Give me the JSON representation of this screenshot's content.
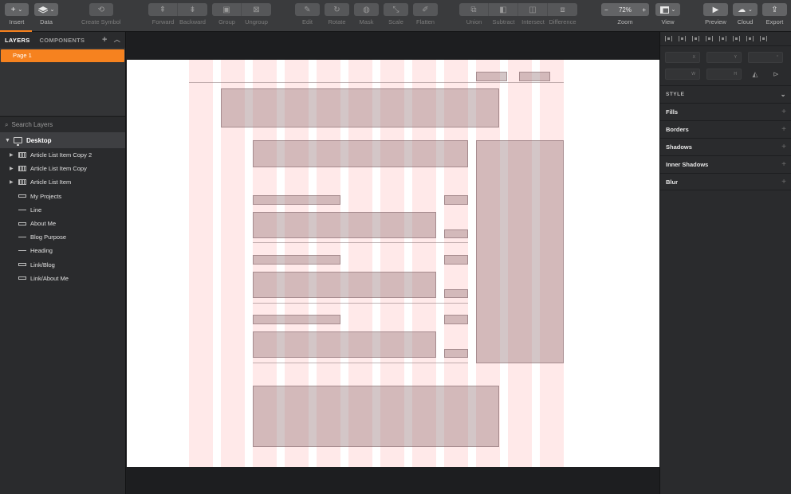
{
  "toolbar": {
    "insert": "Insert",
    "data": "Data",
    "create_symbol": "Create Symbol",
    "forward": "Forward",
    "backward": "Backward",
    "group": "Group",
    "ungroup": "Ungroup",
    "edit": "Edit",
    "rotate": "Rotate",
    "mask": "Mask",
    "scale": "Scale",
    "flatten": "Flatten",
    "union": "Union",
    "subtract": "Subtract",
    "intersect": "Intersect",
    "difference": "Difference",
    "zoom_label": "Zoom",
    "zoom_value": "72%",
    "zoom_minus": "−",
    "zoom_plus": "+",
    "view": "View",
    "preview": "Preview",
    "cloud": "Cloud",
    "export": "Export"
  },
  "left_panel": {
    "tab_layers": "LAYERS",
    "tab_components": "COMPONENTS",
    "add": "+",
    "collapse": "^",
    "page": "Page 1",
    "search_placeholder": "Search Layers",
    "artboard": "Desktop",
    "layers": [
      {
        "label": "Article List Item Copy 2",
        "icon": "group-icon",
        "expandable": true
      },
      {
        "label": "Article List Item Copy",
        "icon": "group-icon",
        "expandable": true
      },
      {
        "label": "Article List Item",
        "icon": "group-icon",
        "expandable": true
      },
      {
        "label": "My Projects",
        "icon": "text-layer-icon",
        "expandable": false
      },
      {
        "label": "Line",
        "icon": "line-icon",
        "expandable": false
      },
      {
        "label": "About Me",
        "icon": "text-layer-icon",
        "expandable": false
      },
      {
        "label": "Blog Purpose",
        "icon": "line-icon",
        "expandable": false
      },
      {
        "label": "Heading",
        "icon": "line-icon",
        "expandable": false
      },
      {
        "label": "Link/Blog",
        "icon": "text-layer-icon",
        "expandable": false
      },
      {
        "label": "Link/About Me",
        "icon": "text-layer-icon",
        "expandable": false
      }
    ]
  },
  "inspector": {
    "x_label": "X",
    "y_label": "Y",
    "w_label": "W",
    "h_label": "H",
    "angle_label": "°",
    "style_header": "STYLE",
    "sections": [
      "Fills",
      "Borders",
      "Shadows",
      "Inner Shadows",
      "Blur"
    ],
    "plus": "+"
  },
  "colors": {
    "accent": "#f6821f",
    "grid_column": "#ffe4e4",
    "block": "#d4c1c3"
  }
}
